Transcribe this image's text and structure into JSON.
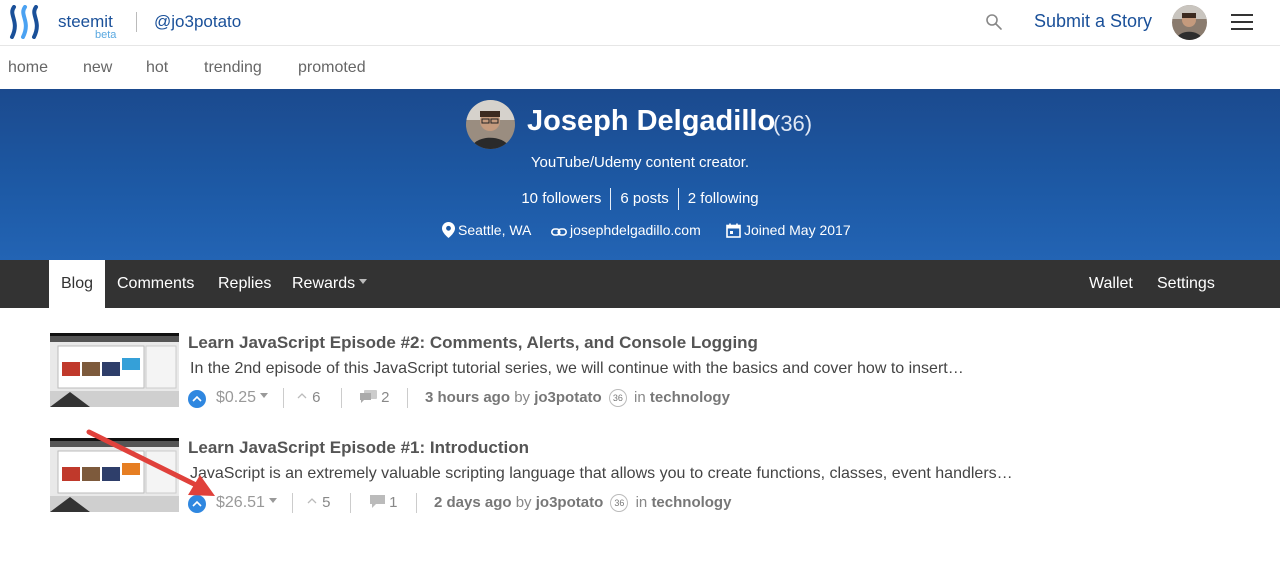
{
  "header": {
    "brand": "steemit",
    "beta": "beta",
    "account": "@jo3potato",
    "submit_label": "Submit a Story"
  },
  "subnav": {
    "items": [
      "home",
      "new",
      "hot",
      "trending",
      "promoted"
    ]
  },
  "profile": {
    "name": "Joseph Delgadillo",
    "reputation": "(36)",
    "about": "YouTube/Udemy content creator.",
    "followers": "10 followers",
    "posts": "6 posts",
    "following": "2 following",
    "location": "Seattle, WA",
    "website": "josephdelgadillo.com",
    "joined": "Joined May 2017",
    "banner_color": "#1d5aa6"
  },
  "tabs": {
    "blog": "Blog",
    "comments": "Comments",
    "replies": "Replies",
    "rewards": "Rewards",
    "wallet": "Wallet",
    "settings": "Settings"
  },
  "posts": [
    {
      "title": "Learn JavaScript Episode #2: Comments, Alerts, and Console Logging",
      "body": "In the 2nd episode of this JavaScript tutorial series, we will continue with the basics and cover how to insert…",
      "payout": "$0.25",
      "votes": "6",
      "comments": "2",
      "time": "3 hours ago",
      "by": "by",
      "author": "jo3potato",
      "author_rep": "36",
      "in": "in",
      "category": "technology"
    },
    {
      "title": "Learn JavaScript Episode #1: Introduction",
      "body": "JavaScript is an extremely valuable scripting language that allows you to create functions, classes, event handlers…",
      "payout": "$26.51",
      "votes": "5",
      "comments": "1",
      "time": "2 days ago",
      "by": "by",
      "author": "jo3potato",
      "author_rep": "36",
      "in": "in",
      "category": "technology"
    }
  ],
  "colors": {
    "link_blue": "#1a5099",
    "upvote_blue": "#2f87e0",
    "annotation_arrow": "#e0413b",
    "tab_bar": "#333333"
  }
}
